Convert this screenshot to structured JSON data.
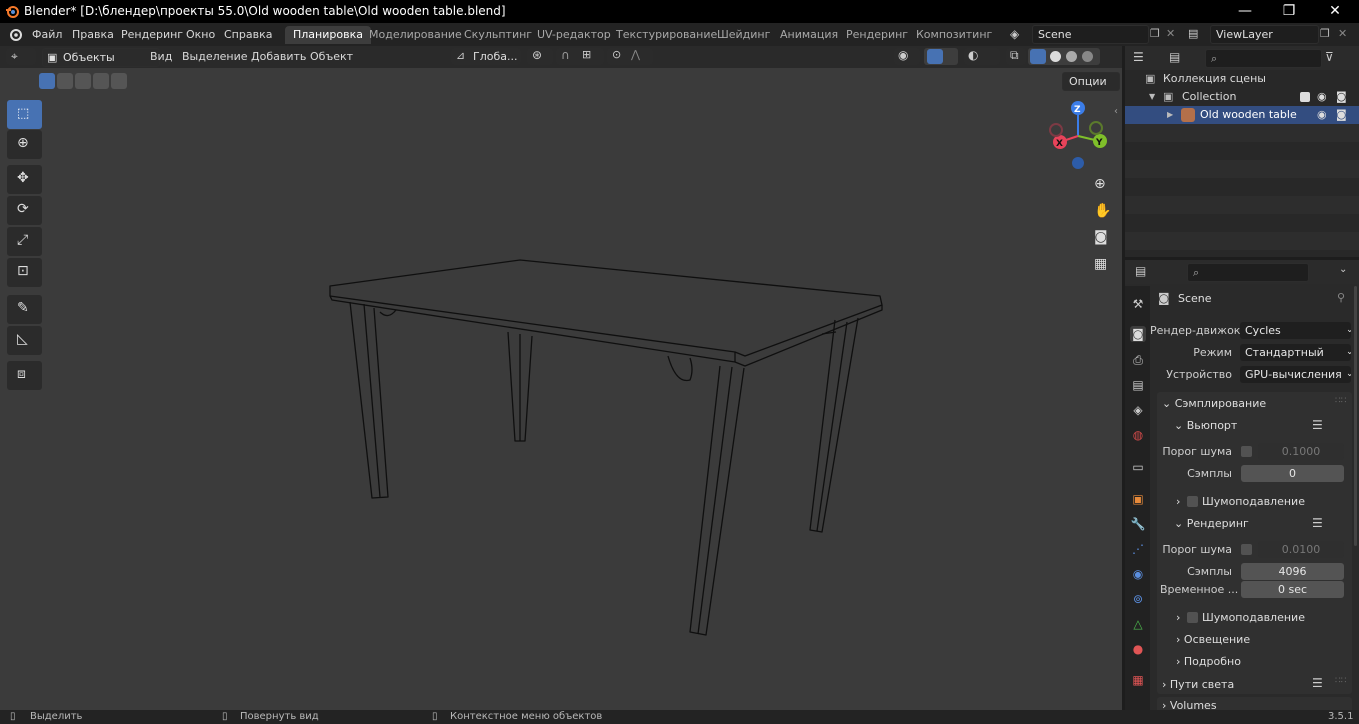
{
  "titlebar": {
    "title": "Blender* [D:\\блендер\\проекты 55.0\\Old wooden table\\Old wooden table.blend]",
    "minimize": "—",
    "maximize": "❐",
    "close": "✕"
  },
  "menubar": {
    "items": [
      "Файл",
      "Правка",
      "Рендеринг",
      "Окно",
      "Справка"
    ],
    "workspaces": [
      "Планировка",
      "Моделирование",
      "Скульптинг",
      "UV-редактор",
      "Текстурирование",
      "Шейдинг",
      "Анимация",
      "Рендеринг",
      "Композитинг"
    ],
    "active_workspace": "Планировка",
    "scene": "Scene",
    "view_layer": "ViewLayer"
  },
  "viewport_header": {
    "mode": "Объекты",
    "menus": [
      "Вид",
      "Выделение",
      "Добавить",
      "Объект"
    ],
    "transform_orientation": "Глоба...",
    "options": "Опции"
  },
  "gizmo": {
    "z": "Z",
    "y": "Y",
    "x": "X"
  },
  "outliner": {
    "root": "Коллекция сцены",
    "collection": "Collection",
    "object": "Old wooden table"
  },
  "properties": {
    "scene_name": "Scene",
    "render_engine_label": "Рендер-движок",
    "render_engine": "Cycles",
    "mode_label": "Режим",
    "mode": "Стандартный",
    "device_label": "Устройство",
    "device": "GPU-вычисления",
    "sampling": "Сэмплирование",
    "viewport": "Вьюпорт",
    "noise_threshold_label": "Порог шума",
    "viewport_noise_threshold": "0.1000",
    "samples_label": "Сэмплы",
    "viewport_samples": "0",
    "denoise": "Шумоподавление",
    "render": "Рендеринг",
    "render_noise_threshold": "0.0100",
    "render_samples": "4096",
    "time_limit_label": "Временное ...",
    "time_limit": "0 sec",
    "lights": "Освещение",
    "advanced": "Подробно",
    "light_paths": "Пути света",
    "volumes": "Volumes"
  },
  "statusbar": {
    "select": "Выделить",
    "rotate": "Повернуть вид",
    "context": "Контекстное меню объектов",
    "version": "3.5.1"
  },
  "colors": {
    "accent": "#4772b3",
    "viewport_bg": "#3b3b3b",
    "selection": "#334d80"
  }
}
